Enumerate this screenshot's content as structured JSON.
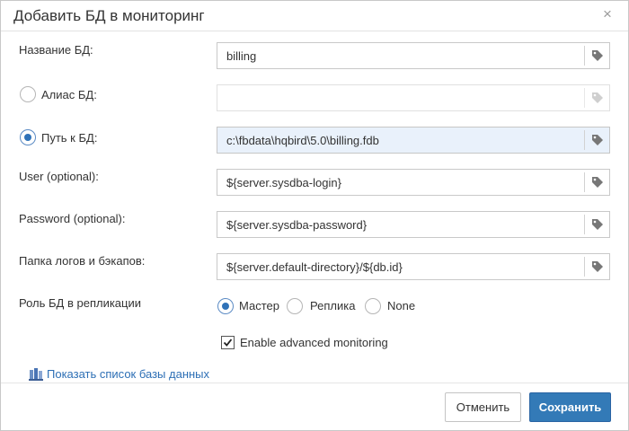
{
  "dialog": {
    "title": "Добавить БД в мониторинг",
    "close_glyph": "×"
  },
  "form": {
    "db_name": {
      "label": "Название БД:",
      "value": "billing",
      "icon": "tag-icon"
    },
    "alias": {
      "label": "Алиас БД:",
      "value": "",
      "selected": false,
      "icon": "tag-icon"
    },
    "path": {
      "label": "Путь к БД:",
      "value": "c:\\fbdata\\hqbird\\5.0\\billing.fdb",
      "selected": true,
      "icon": "tag-icon"
    },
    "user": {
      "label": "User (optional):",
      "value": "${server.sysdba-login}",
      "icon": "tag-icon"
    },
    "password": {
      "label": "Password (optional):",
      "value": "${server.sysdba-password}",
      "icon": "tag-icon"
    },
    "logs_folder": {
      "label": "Папка логов и бэкапов:",
      "value": "${server.default-directory}/${db.id}",
      "icon": "tag-icon"
    },
    "replication_role": {
      "label": "Роль БД в репликации",
      "options": [
        {
          "label": "Мастер",
          "selected": true
        },
        {
          "label": "Реплика",
          "selected": false
        },
        {
          "label": "None",
          "selected": false
        }
      ]
    },
    "advanced_monitoring": {
      "label": "Enable advanced monitoring",
      "checked": true
    }
  },
  "footer": {
    "show_db_list_link": "Показать список базы данных",
    "cancel_label": "Отменить",
    "save_label": "Сохранить"
  },
  "colors": {
    "accent": "#337ab7",
    "link": "#2d6fb5",
    "active_field_bg": "#e9f1fb"
  }
}
